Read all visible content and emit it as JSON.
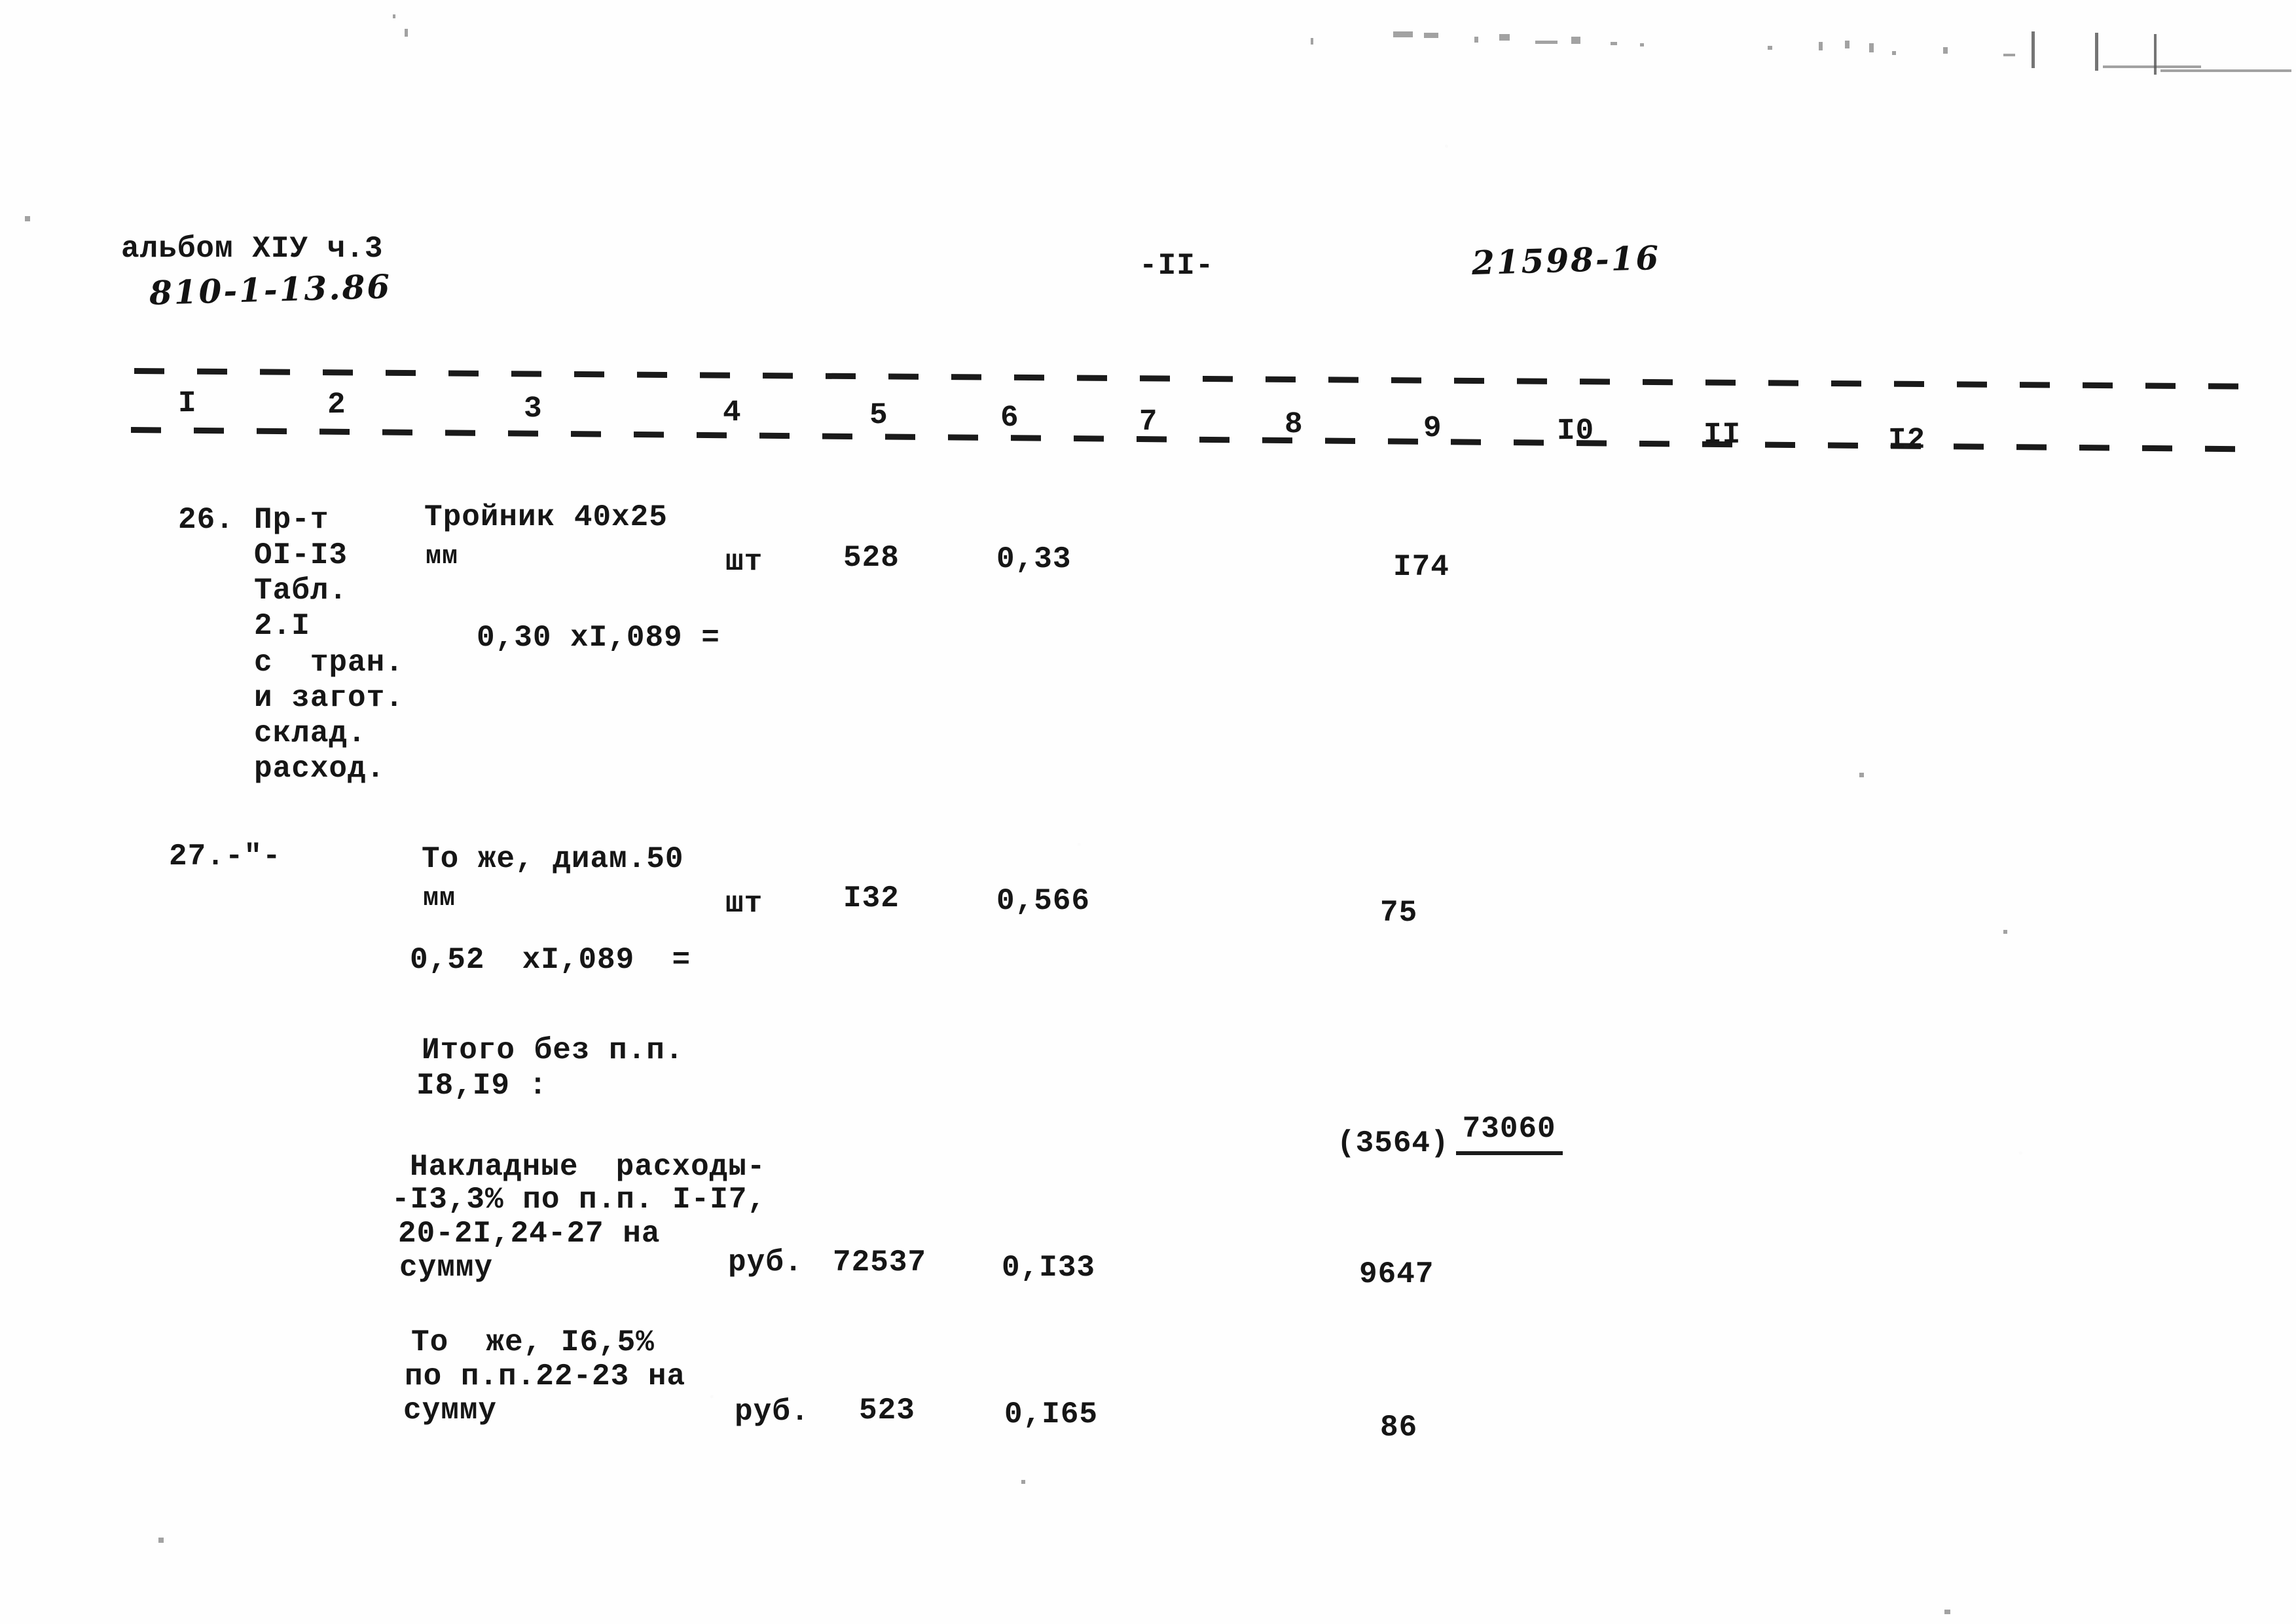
{
  "document": {
    "album_label": "альбом ХIУ ч.3",
    "album_code": "810-1-13.86",
    "page_marker": "-II-",
    "archive_number": "21598-16"
  },
  "table": {
    "column_numbers": [
      "I",
      "2",
      "3",
      "4",
      "5",
      "6",
      "7",
      "8",
      "9",
      "I0",
      "II",
      "I2"
    ],
    "rows": [
      {
        "item_no": "26.",
        "reference_lines": [
          "Пр-т",
          "OI-I3",
          "Табл.",
          "2.I",
          "с  тран.",
          "и загот.",
          "склад.",
          "расход."
        ],
        "description_lines": [
          "Тройник 40х25",
          "мм"
        ],
        "formula": "0,30 хI,089 =",
        "unit": "шт",
        "quantity": "528",
        "unit_price": "0,33",
        "total": "I74"
      },
      {
        "item_no": "27.-\"-",
        "reference_lines": [],
        "description_lines": [
          "То же, диам.50",
          "мм"
        ],
        "formula": "0,52  хI,089  =",
        "unit": "шт",
        "quantity": "I32",
        "unit_price": "0,566",
        "total": "75"
      }
    ],
    "summary": [
      {
        "label_lines": [
          "Итого без п.п.",
          "I8,I9 :"
        ],
        "unit": "",
        "quantity": "",
        "unit_price": "",
        "total": "73060",
        "total_underlined": true,
        "sub_total": "(3564)"
      },
      {
        "label_lines": [
          "Накладные  расходы-",
          "-I3,3% по п.п. I-I7,",
          "20-2I,24-27 на",
          "сумму"
        ],
        "unit": "руб.",
        "quantity": "72537",
        "unit_price": "0,I33",
        "total": "9647",
        "total_underlined": false,
        "sub_total": ""
      },
      {
        "label_lines": [
          "То  же, I6,5%",
          "по п.п.22-23 на",
          "сумму"
        ],
        "unit": "руб.",
        "quantity": "523",
        "unit_price": "0,I65",
        "total": "86",
        "total_underlined": false,
        "sub_total": ""
      }
    ]
  }
}
